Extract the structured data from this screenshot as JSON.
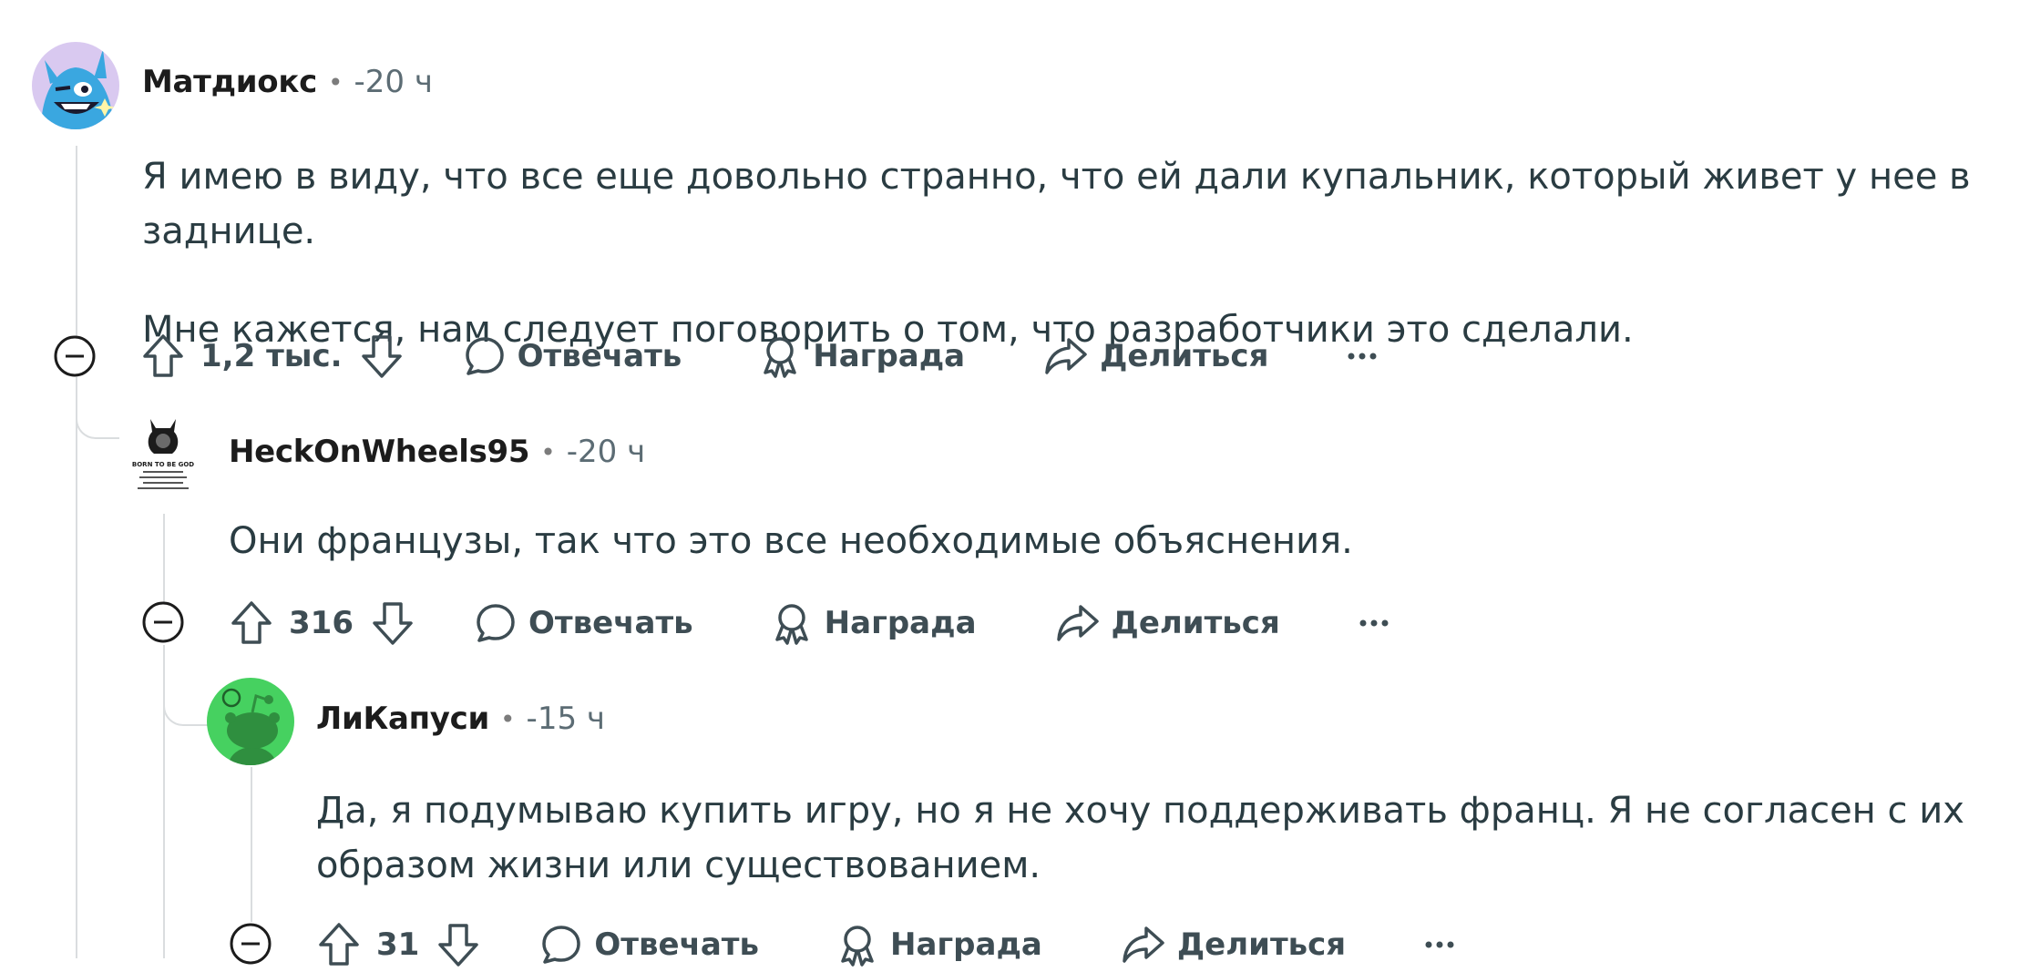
{
  "comments": [
    {
      "author": "Матдиокс",
      "separator": "•",
      "time": "-20 ч",
      "paragraphs": [
        "Я имею в виду, что все еще довольно странно, что ей дали купальник, который живет у нее в заднице.",
        "Мне кажется, нам следует поговорить о том, что разработчики это сделали."
      ],
      "votes": "1,2 тыс.",
      "reply_label": "Отвечать",
      "award_label": "Награда",
      "share_label": "Делиться",
      "avatar": "blue-cartoon-character"
    },
    {
      "author": "HeckOnWheels95",
      "separator": "•",
      "time": "-20 ч",
      "paragraphs": [
        "Они французы, так что это все необходимые объяснения."
      ],
      "votes": "316",
      "reply_label": "Отвечать",
      "award_label": "Награда",
      "share_label": "Делиться",
      "avatar": "born-to-be-god-poster",
      "avatar_text": "BORN TO BE GOD"
    },
    {
      "author": "ЛиКапуси",
      "separator": "•",
      "time": "-15 ч",
      "paragraphs": [
        "Да, я подумываю купить игру, но я не хочу поддерживать франц. Я не согласен с их образом жизни или существованием."
      ],
      "votes": "31",
      "reply_label": "Отвечать",
      "award_label": "Награда",
      "share_label": "Делиться",
      "avatar": "reddit-snoo-green"
    }
  ],
  "colors": {
    "thread_line": "#dadddf",
    "text": "#2a3c42",
    "meta": "#5c6c74",
    "snoo_bg": "#46d160"
  },
  "icons": [
    "collapse-icon",
    "upvote-icon",
    "downvote-icon",
    "comment-icon",
    "award-icon",
    "share-icon",
    "more-icon"
  ]
}
